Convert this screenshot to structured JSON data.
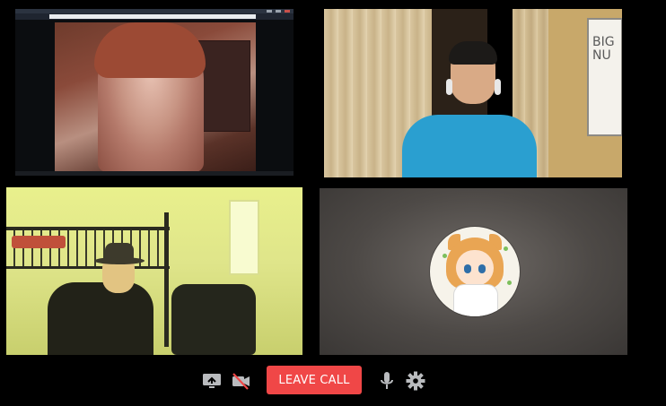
{
  "participants": [
    {
      "id": "tile-1",
      "kind": "screenshare-video"
    },
    {
      "id": "tile-2",
      "kind": "camera-video",
      "whiteboard_text": "BIG\nNU"
    },
    {
      "id": "tile-3",
      "kind": "camera-video"
    },
    {
      "id": "tile-4",
      "kind": "avatar"
    }
  ],
  "controls": {
    "screenshare_icon": "screenshare-icon",
    "video_icon": "video-off-icon",
    "leave_label": "LEAVE CALL",
    "mic_icon": "microphone-icon",
    "settings_icon": "gear-icon"
  },
  "colors": {
    "background": "#000000",
    "leave_button": "#f04747",
    "icon": "#b9bbbe",
    "video_off_slash": "#f04747"
  }
}
